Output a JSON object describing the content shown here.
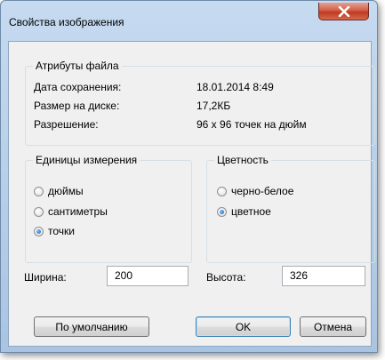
{
  "window": {
    "title": "Свойства изображения"
  },
  "file_attributes": {
    "title": "Атрибуты файла",
    "rows": [
      {
        "label": "Дата сохранения:",
        "value": "18.01.2014 8:49"
      },
      {
        "label": "Размер на диске:",
        "value": "17,2КБ"
      },
      {
        "label": "Разрешение:",
        "value": "96 x 96 точек на дюйм"
      }
    ]
  },
  "units": {
    "title": "Единицы измерения",
    "options": [
      "дюймы",
      "сантиметры",
      "точки"
    ],
    "selected": "точки"
  },
  "color": {
    "title": "Цветность",
    "options": [
      "черно-белое",
      "цветное"
    ],
    "selected": "цветное"
  },
  "size": {
    "width_label": "Ширина:",
    "width_value": "200",
    "height_label": "Высота:",
    "height_value": "326"
  },
  "buttons": {
    "default": "По умолчанию",
    "ok": "OK",
    "cancel": "Отмена"
  }
}
